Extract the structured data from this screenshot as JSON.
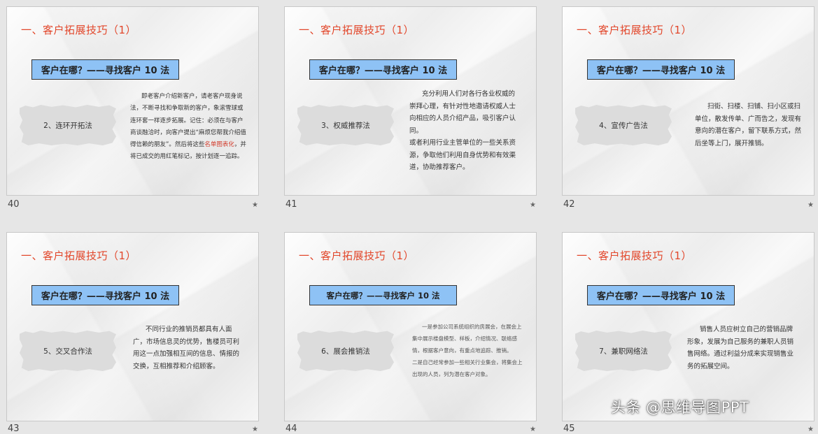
{
  "slides": [
    {
      "title": "一、客户拓展技巧（1）",
      "subtitle": "客户在哪？——寻找客户 10 法",
      "method": "2、连环开拓法",
      "body_before": "即老客户介绍新客户，请老客户现身说法，不断寻找和争取新的客户，象滚雪球或连环套一样逐步拓展。记住：必须在与客户商谈融洽时，向客户提出“麻烦您帮我介绍值得信赖的朋友”。然后将这些",
      "highlight": "名单图表化",
      "body_after": "，并将已成交的用红笔标记，按计划逐一追踪。",
      "page": "40"
    },
    {
      "title": "一、客户拓展技巧（1）",
      "subtitle": "客户在哪？——寻找客户 10 法",
      "method": "3、权威推荐法",
      "body": "充分利用人们对各行各业权威的崇拜心理，有针对性地邀请权威人士向相应的人员介绍产品，吸引客户认同。\n或者利用行业主管单位的一些关系资源，争取他们利用自身优势和有效渠道，协助推荐客户。",
      "page": "41"
    },
    {
      "title": "一、客户拓展技巧（1）",
      "subtitle": "客户在哪？——寻找客户 10 法",
      "method": "4、宣传广告法",
      "body": "扫街、扫楼、扫铺、扫小区或扫单位，散发传单、广而告之，发现有意向的潜在客户，留下联系方式，然后坐等上门，展开推销。",
      "page": "42"
    },
    {
      "title": "一、客户拓展技巧（1）",
      "subtitle": "客户在哪？——寻找客户 10 法",
      "method": "5、交叉合作法",
      "body": "不同行业的推销员都具有人面广，市场信息灵的优势，售楼员可利用这一点加强相互间的信息、情报的交换，互相推荐和介绍顾客。",
      "page": "43"
    },
    {
      "title": "一、客户拓展技巧（1）",
      "subtitle": "客户在哪？——寻找客户 10 法",
      "method": "6、展会推销法",
      "body": "一是参加公司系统组织的房展会，在展会上集中展示楼盘模型、样板，介绍情况、联络感情，根据客户意向，有重点地追踪、推销。\n二是自己经常参加一些相关行业集会，将集会上出现的人员，列为潜在客户对象。",
      "page": "44"
    },
    {
      "title": "一、客户拓展技巧（1）",
      "subtitle": "客户在哪？——寻找客户 10 法",
      "method": "7、兼职网络法",
      "body": "销售人员应树立自己的营销品牌形象，发展为自己服务的兼职人员销售网络。通过利益分成来实现销售业务的拓展空间。",
      "page": "45"
    }
  ],
  "star_icon": "star-icon",
  "watermark": "头条 @思维导图PPT",
  "colors": {
    "title": "#e2462a",
    "subtitle_bg": "#8ec2f5",
    "highlight": "#d23a2a"
  }
}
